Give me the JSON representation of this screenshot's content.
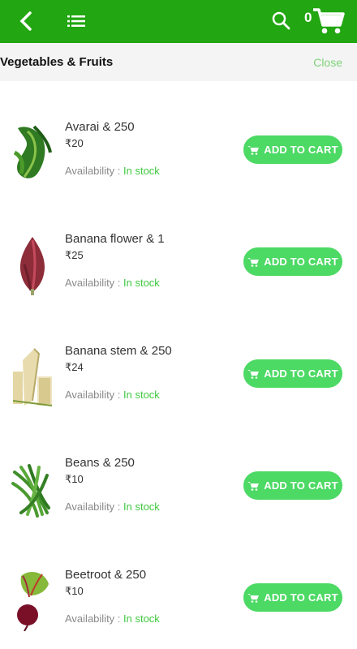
{
  "header": {
    "cart_count": "0",
    "icons": [
      "back-arrow-icon",
      "menu-list-icon",
      "search-icon",
      "cart-icon"
    ]
  },
  "category": {
    "title": "Vegetables & Fruits",
    "close_label": "Close"
  },
  "labels": {
    "availability": "Availability : ",
    "add_to_cart": "ADD TO CART"
  },
  "products": [
    {
      "name": "Avarai & 250",
      "price": "₹20",
      "stock": "In stock"
    },
    {
      "name": "Banana flower & 1",
      "price": "₹25",
      "stock": "In stock"
    },
    {
      "name": "Banana stem & 250",
      "price": "₹24",
      "stock": "In stock"
    },
    {
      "name": "Beans & 250",
      "price": "₹10",
      "stock": "In stock"
    },
    {
      "name": "Beetroot & 250",
      "price": "₹10",
      "stock": "In stock"
    }
  ],
  "colors": {
    "topbar": "#22a611",
    "button": "#4cd964",
    "in_stock": "#3fc93f",
    "close": "#7ed37a"
  }
}
